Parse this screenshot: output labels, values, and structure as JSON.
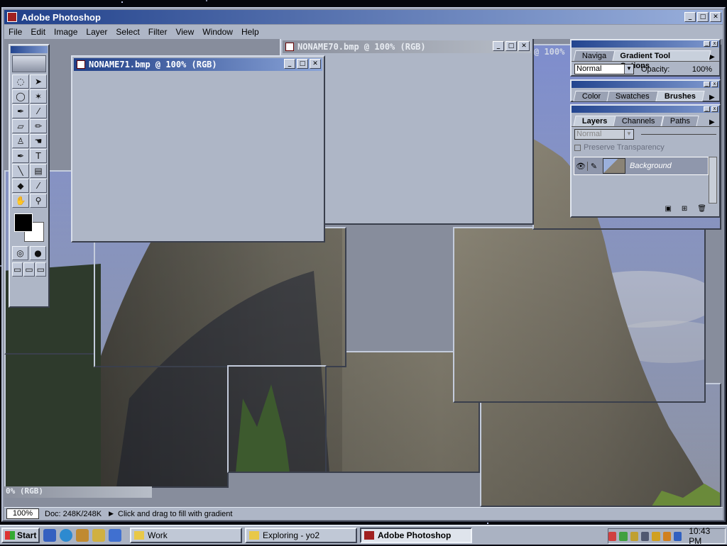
{
  "app": {
    "title": "Adobe Photoshop",
    "menu": [
      "File",
      "Edit",
      "Image",
      "Layer",
      "Select",
      "Filter",
      "View",
      "Window",
      "Help"
    ]
  },
  "documents": {
    "front": {
      "title": "NONAME71.bmp @ 100% (RGB)"
    },
    "back": {
      "title": "NONAME70.bmp @ 100% (RGB)"
    },
    "partial_title_right": "@ 100%",
    "partial_title_bottom": "0% (RGB)"
  },
  "toolbox": {
    "tools": [
      "marquee-icon",
      "move-icon",
      "lasso-icon",
      "magic-wand-icon",
      "airbrush-icon",
      "paintbrush-icon",
      "eraser-icon",
      "pencil-icon",
      "rubber-stamp-icon",
      "smudge-icon",
      "pen-icon",
      "type-icon",
      "line-icon",
      "gradient-icon",
      "paint-bucket-icon",
      "eyedropper-icon",
      "hand-icon",
      "zoom-icon"
    ],
    "type_label": "T",
    "foreground_color": "#000000",
    "background_color": "#ffffff"
  },
  "palettes": {
    "gradient": {
      "tabs": [
        "Naviga",
        "Gradient Tool Options"
      ],
      "active_tab": "Gradient Tool Options",
      "mode": "Normal",
      "opacity_label": "Opacity:",
      "opacity_value": "100%"
    },
    "color": {
      "tabs": [
        "Color",
        "Swatches",
        "Brushes"
      ],
      "active_tab": "Brushes"
    },
    "layers": {
      "tabs": [
        "Layers",
        "Channels",
        "Paths"
      ],
      "active_tab": "Layers",
      "mode": "Normal",
      "preserve_label": "Preserve Transparency",
      "layer_name": "Background"
    }
  },
  "status": {
    "zoom": "100%",
    "doc_info": "Doc: 248K/248K",
    "hint": "Click and drag to fill with gradient"
  },
  "taskbar": {
    "start_label": "Start",
    "tasks": [
      {
        "label": "Work",
        "active": false
      },
      {
        "label": "Exploring - yo2",
        "active": false
      },
      {
        "label": "Adobe Photoshop",
        "active": true
      }
    ],
    "clock": "10:43 PM"
  },
  "colors": {
    "titlebar_active": "#1f3e86",
    "desktop": "#05060c",
    "chrome": "#aeb6c6"
  }
}
